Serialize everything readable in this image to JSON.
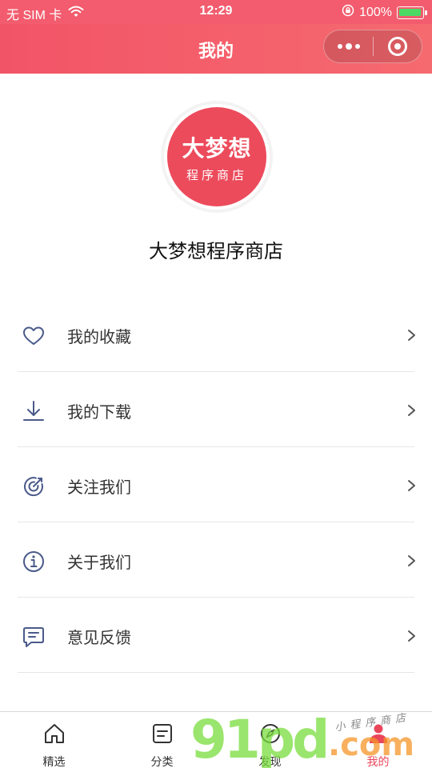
{
  "status_bar": {
    "carrier": "无 SIM 卡",
    "time": "12:29",
    "battery_percent": "100%",
    "battery_level": 1.0,
    "icons": [
      "wifi-icon",
      "orientation-lock-icon",
      "battery-icon"
    ]
  },
  "nav": {
    "title": "我的",
    "capsule_icons": [
      "more-icon",
      "close-miniprogram-icon"
    ]
  },
  "profile": {
    "avatar_line1": "大梦想",
    "avatar_line2": "程序商店",
    "name": "大梦想程序商店",
    "avatar_color": "#ec4b5c"
  },
  "menu": {
    "items": [
      {
        "label": "我的收藏",
        "icon": "heart-icon"
      },
      {
        "label": "我的下载",
        "icon": "download-icon"
      },
      {
        "label": "关注我们",
        "icon": "target-icon"
      },
      {
        "label": "关于我们",
        "icon": "info-icon"
      },
      {
        "label": "意见反馈",
        "icon": "feedback-icon"
      }
    ]
  },
  "tabbar": {
    "tabs": [
      {
        "label": "精选",
        "icon": "home-icon",
        "active": false
      },
      {
        "label": "分类",
        "icon": "category-icon",
        "active": false
      },
      {
        "label": "发现",
        "icon": "compass-icon",
        "active": false
      },
      {
        "label": "我的",
        "icon": "user-icon",
        "active": true
      }
    ],
    "active_color": "#e9465a"
  },
  "watermark": {
    "brand": "91pd",
    "domain": ".com",
    "tagline": "小程序商店"
  },
  "colors": {
    "header": "#f25c6e",
    "accent": "#e9465a",
    "icon": "#4a5a8a"
  }
}
